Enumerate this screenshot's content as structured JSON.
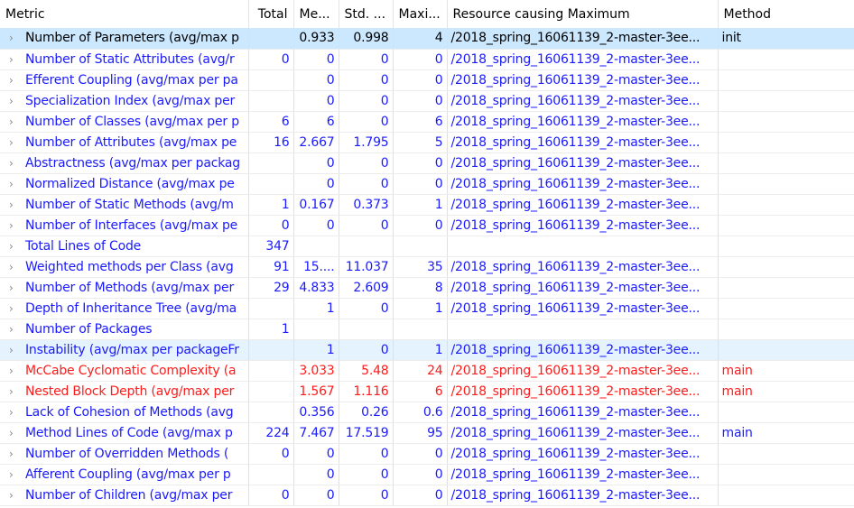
{
  "columns": [
    "Metric",
    "Total",
    "Me...",
    "Std. ...",
    "Maxi...",
    "Resource causing Maximum",
    "Method"
  ],
  "colors": {
    "blue": "#1a1aff",
    "red": "#ff1a1a",
    "selected": "#cce8ff",
    "hover": "#e5f3ff"
  },
  "rows": [
    {
      "metric": "Number of Parameters (avg/max p",
      "total": "",
      "mean": "0.933",
      "std": "0.998",
      "max": "4",
      "resource": "/2018_spring_16061139_2-master-3ee...",
      "method": "init",
      "style": "black sel"
    },
    {
      "metric": "Number of Static Attributes (avg/r",
      "total": "0",
      "mean": "0",
      "std": "0",
      "max": "0",
      "resource": "/2018_spring_16061139_2-master-3ee...",
      "method": "",
      "style": "blue"
    },
    {
      "metric": "Efferent Coupling (avg/max per pa",
      "total": "",
      "mean": "0",
      "std": "0",
      "max": "0",
      "resource": "/2018_spring_16061139_2-master-3ee...",
      "method": "",
      "style": "blue"
    },
    {
      "metric": "Specialization Index (avg/max per",
      "total": "",
      "mean": "0",
      "std": "0",
      "max": "0",
      "resource": "/2018_spring_16061139_2-master-3ee...",
      "method": "",
      "style": "blue"
    },
    {
      "metric": "Number of Classes (avg/max per p",
      "total": "6",
      "mean": "6",
      "std": "0",
      "max": "6",
      "resource": "/2018_spring_16061139_2-master-3ee...",
      "method": "",
      "style": "blue"
    },
    {
      "metric": "Number of Attributes (avg/max pe",
      "total": "16",
      "mean": "2.667",
      "std": "1.795",
      "max": "5",
      "resource": "/2018_spring_16061139_2-master-3ee...",
      "method": "",
      "style": "blue"
    },
    {
      "metric": "Abstractness (avg/max per packag",
      "total": "",
      "mean": "0",
      "std": "0",
      "max": "0",
      "resource": "/2018_spring_16061139_2-master-3ee...",
      "method": "",
      "style": "blue"
    },
    {
      "metric": "Normalized Distance (avg/max pe",
      "total": "",
      "mean": "0",
      "std": "0",
      "max": "0",
      "resource": "/2018_spring_16061139_2-master-3ee...",
      "method": "",
      "style": "blue"
    },
    {
      "metric": "Number of Static Methods (avg/m",
      "total": "1",
      "mean": "0.167",
      "std": "0.373",
      "max": "1",
      "resource": "/2018_spring_16061139_2-master-3ee...",
      "method": "",
      "style": "blue"
    },
    {
      "metric": "Number of Interfaces (avg/max pe",
      "total": "0",
      "mean": "0",
      "std": "0",
      "max": "0",
      "resource": "/2018_spring_16061139_2-master-3ee...",
      "method": "",
      "style": "blue"
    },
    {
      "metric": "Total Lines of Code",
      "total": "347",
      "mean": "",
      "std": "",
      "max": "",
      "resource": "",
      "method": "",
      "style": "blue"
    },
    {
      "metric": "Weighted methods per Class (avg",
      "total": "91",
      "mean": "15....",
      "std": "11.037",
      "max": "35",
      "resource": "/2018_spring_16061139_2-master-3ee...",
      "method": "",
      "style": "blue"
    },
    {
      "metric": "Number of Methods (avg/max per",
      "total": "29",
      "mean": "4.833",
      "std": "2.609",
      "max": "8",
      "resource": "/2018_spring_16061139_2-master-3ee...",
      "method": "",
      "style": "blue"
    },
    {
      "metric": "Depth of Inheritance Tree (avg/ma",
      "total": "",
      "mean": "1",
      "std": "0",
      "max": "1",
      "resource": "/2018_spring_16061139_2-master-3ee...",
      "method": "",
      "style": "blue"
    },
    {
      "metric": "Number of Packages",
      "total": "1",
      "mean": "",
      "std": "",
      "max": "",
      "resource": "",
      "method": "",
      "style": "blue"
    },
    {
      "metric": "Instability (avg/max per packageFr",
      "total": "",
      "mean": "1",
      "std": "0",
      "max": "1",
      "resource": "/2018_spring_16061139_2-master-3ee...",
      "method": "",
      "style": "blue hov"
    },
    {
      "metric": "McCabe Cyclomatic Complexity (a",
      "total": "",
      "mean": "3.033",
      "std": "5.48",
      "max": "24",
      "resource": "/2018_spring_16061139_2-master-3ee...",
      "method": "main",
      "style": "red"
    },
    {
      "metric": "Nested Block Depth (avg/max per",
      "total": "",
      "mean": "1.567",
      "std": "1.116",
      "max": "6",
      "resource": "/2018_spring_16061139_2-master-3ee...",
      "method": "main",
      "style": "red"
    },
    {
      "metric": "Lack of Cohesion of Methods (avg",
      "total": "",
      "mean": "0.356",
      "std": "0.26",
      "max": "0.6",
      "resource": "/2018_spring_16061139_2-master-3ee...",
      "method": "",
      "style": "blue"
    },
    {
      "metric": "Method Lines of Code (avg/max p",
      "total": "224",
      "mean": "7.467",
      "std": "17.519",
      "max": "95",
      "resource": "/2018_spring_16061139_2-master-3ee...",
      "method": "main",
      "style": "blue"
    },
    {
      "metric": "Number of Overridden Methods (",
      "total": "0",
      "mean": "0",
      "std": "0",
      "max": "0",
      "resource": "/2018_spring_16061139_2-master-3ee...",
      "method": "",
      "style": "blue"
    },
    {
      "metric": "Afferent Coupling (avg/max per p",
      "total": "",
      "mean": "0",
      "std": "0",
      "max": "0",
      "resource": "/2018_spring_16061139_2-master-3ee...",
      "method": "",
      "style": "blue"
    },
    {
      "metric": "Number of Children (avg/max per",
      "total": "0",
      "mean": "0",
      "std": "0",
      "max": "0",
      "resource": "/2018_spring_16061139_2-master-3ee...",
      "method": "",
      "style": "blue"
    }
  ]
}
